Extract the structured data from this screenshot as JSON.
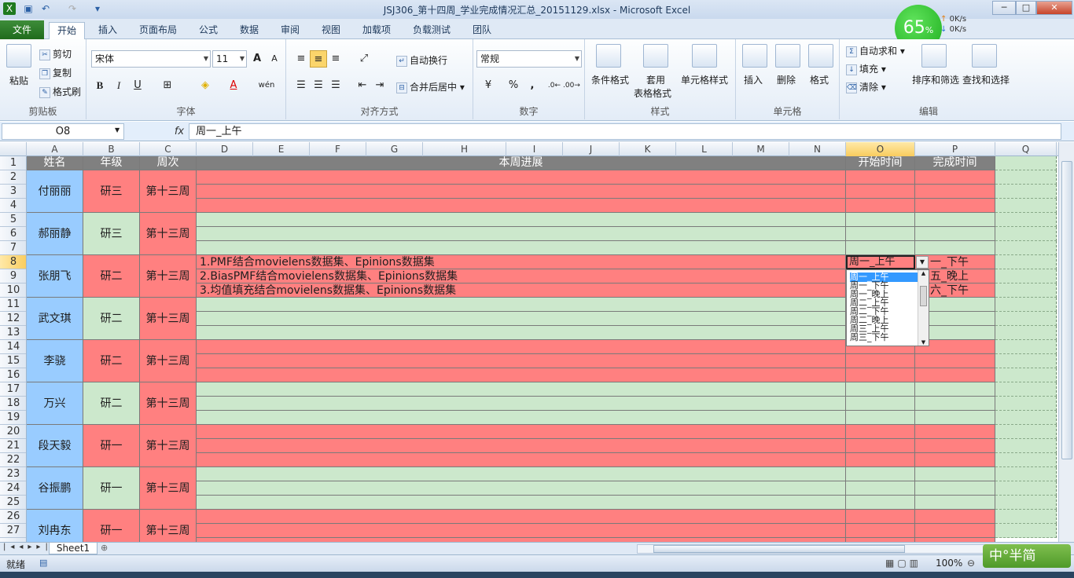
{
  "window": {
    "title": "JSJ306_第十四周_学业完成情况汇总_20151129.xlsx - Microsoft Excel"
  },
  "speed": {
    "percent": "65",
    "unit": "%",
    "up": "0K/s",
    "down": "0K/s"
  },
  "tabs": [
    "文件",
    "开始",
    "插入",
    "页面布局",
    "公式",
    "数据",
    "审阅",
    "视图",
    "加载项",
    "负载测试",
    "团队"
  ],
  "ribbon": {
    "clipboard": {
      "paste": "粘贴",
      "cut": "剪切",
      "copy": "复制",
      "format_painter": "格式刷",
      "label": "剪贴板"
    },
    "font": {
      "name": "宋体",
      "size": "11",
      "label": "字体",
      "bold": "B",
      "italic": "I",
      "underline": "U",
      "grow": "A",
      "shrink": "A",
      "font_color": "A",
      "phonetic": "wén"
    },
    "align": {
      "wrap": "自动换行",
      "merge": "合并后居中",
      "label": "对齐方式"
    },
    "number": {
      "format": "常规",
      "label": "数字",
      "percent": "%",
      "comma": ","
    },
    "styles": {
      "cond": "条件格式",
      "table1": "套用",
      "table2": "表格格式",
      "cell": "单元格样式",
      "label": "样式"
    },
    "cells": {
      "insert": "插入",
      "delete": "删除",
      "format": "格式",
      "label": "单元格"
    },
    "edit": {
      "autosum": "自动求和",
      "fill": "填充",
      "clear": "清除",
      "sort": "排序和筛选",
      "find": "查找和选择",
      "label": "编辑"
    }
  },
  "formula": {
    "cell": "O8",
    "fx": "fx",
    "value": "周一_上午"
  },
  "columns": [
    "A",
    "B",
    "C",
    "D",
    "E",
    "F",
    "G",
    "H",
    "I",
    "J",
    "K",
    "L",
    "M",
    "N",
    "O",
    "P",
    "Q"
  ],
  "rows": [
    "1",
    "2",
    "3",
    "4",
    "5",
    "6",
    "7",
    "8",
    "9",
    "10",
    "11",
    "12",
    "13",
    "14",
    "15",
    "16",
    "17",
    "18",
    "19",
    "20",
    "21",
    "22",
    "23",
    "24",
    "25",
    "26",
    "27"
  ],
  "headers": {
    "name": "姓名",
    "grade": "年级",
    "week": "周次",
    "progress": "本周进展",
    "start": "开始时间",
    "end": "完成时间"
  },
  "students": [
    {
      "name": "付丽丽",
      "grade": "研三",
      "week": "第十三周"
    },
    {
      "name": "郝丽静",
      "grade": "研三",
      "week": "第十三周"
    },
    {
      "name": "张朋飞",
      "grade": "研二",
      "week": "第十三周"
    },
    {
      "name": "武文琪",
      "grade": "研二",
      "week": "第十三周"
    },
    {
      "name": "李骁",
      "grade": "研二",
      "week": "第十三周"
    },
    {
      "name": "万兴",
      "grade": "研二",
      "week": "第十三周"
    },
    {
      "name": "段天毅",
      "grade": "研一",
      "week": "第十三周"
    },
    {
      "name": "谷振鹏",
      "grade": "研一",
      "week": "第十三周"
    },
    {
      "name": "刘冉东",
      "grade": "研一",
      "week": "第十三周"
    }
  ],
  "progress": [
    "1.PMF结合movielens数据集、Epinions数据集",
    "2.BiasPMF结合movielens数据集、Epinions数据集",
    "3.均值填充结合movielens数据集、Epinions数据集"
  ],
  "o8_value": "周一_上午",
  "p_values": [
    "一_下午",
    "五_晚上",
    "六_下午"
  ],
  "dropdown": [
    "周一_上午",
    "周一_下午",
    "周一_晚上",
    "周二_上午",
    "周二_下午",
    "周二_晚上",
    "周三_上午",
    "周三_下午"
  ],
  "sheet": {
    "name": "Sheet1"
  },
  "status": {
    "ready": "就绪",
    "zoom": "100%"
  },
  "ime": {
    "text": "中°半简"
  }
}
